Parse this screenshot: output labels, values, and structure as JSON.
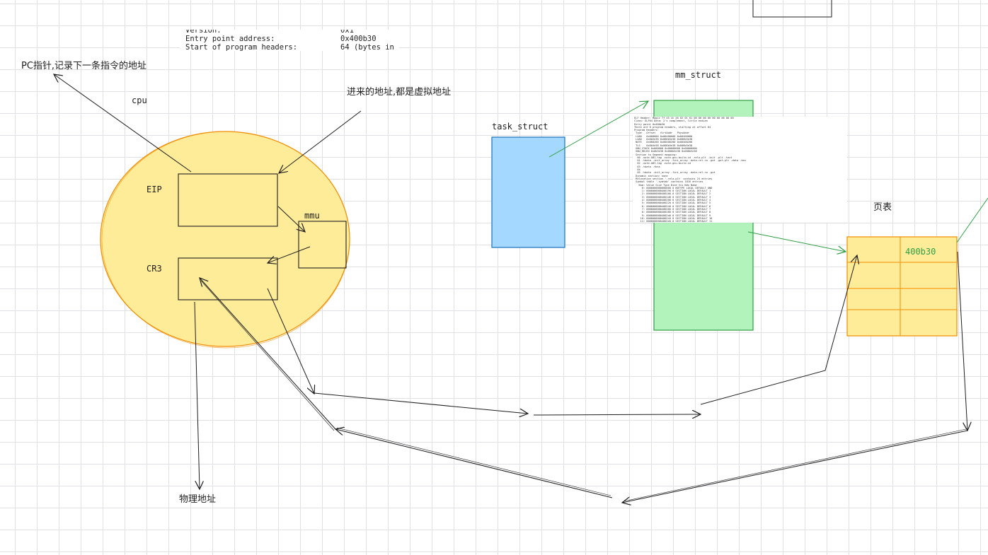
{
  "labels": {
    "pc_note": "PC指针,记录下一条指令的地址",
    "cpu": "cpu",
    "incoming_note": "进来的地址,都是虚拟地址",
    "eip": "EIP",
    "cr3": "CR3",
    "mmu": "mmu",
    "physical_addr": "物理地址",
    "task_struct": "task_struct",
    "mm_struct": "mm_struct",
    "page_table": "页表",
    "page_table_entry": "400b30"
  },
  "elf_header_snippet": [
    {
      "key": "Version:",
      "value": "0x1"
    },
    {
      "key": "Entry point address:",
      "value": "0x400b30"
    },
    {
      "key": "Start of program headers:",
      "value": "64 (bytes in"
    }
  ],
  "readelf_lines": [
    "ELF Header: Magic 7f 45 4c 46 02 01 01 00 00 00 00 00 00 00 00 00",
    "Class: ELF64 Data: 2's complement, little endian",
    "Entry point 0x400b30",
    "There are 8 program headers, starting at offset 64",
    "Program Headers:",
    " Type   Offset   VirtAddr   PhysAddr",
    " LOAD   0x000000 0x00400000 0x00400000",
    " LOAD   0x0b5e38 0x006b5e38 0x006b5e38",
    " NOTE   0x000200 0x00400200 0x00400200",
    " TLS    0x0b5e38 0x006b5e38 0x006b5e38",
    " GNU_STACK 0x000000 0x00000000 0x00000000",
    " GNU_RELRO 0x0b5e38 0x006b5e38 0x006b5e38",
    " Section to Segment mapping:",
    "  00 .note.ABI-tag .note.gnu.build-id .rela.plt .init .plt .text",
    "  01 .tdata .init_array .fini_array .data.rel.ro .got .got.plt .data .bss",
    "  02 .note.ABI-tag .note.gnu.build-id",
    "  03 .tdata .tbss",
    "  04",
    "  05 .tdata .init_array .fini_array .data.rel.ro .got",
    " Dynamic section: none",
    " Relocation section '.rela.plt' contains 24 entries",
    " Symbol table '.symtab' contains 1816 entries",
    "   Num: Value Size Type Bind Vis Ndx Name",
    "     0: 0000000000000000 0 NOTYPE LOCAL DEFAULT UND",
    "     1: 0000000000400190 0 SECTION LOCAL DEFAULT 1",
    "     2: 00000000004001b0 0 SECTION LOCAL DEFAULT 2",
    "     3: 00000000004001d8 0 SECTION LOCAL DEFAULT 3",
    "     4: 0000000000400200 0 SECTION LOCAL DEFAULT 4",
    "     5: 0000000000400220 0 SECTION LOCAL DEFAULT 5",
    "     6: 0000000000400240 0 SECTION LOCAL DEFAULT 6",
    "     7: 0000000000400260 0 SECTION LOCAL DEFAULT 7",
    "     8: 0000000000400280 0 SECTION LOCAL DEFAULT 8",
    "     9: 00000000004002a0 0 SECTION LOCAL DEFAULT 9",
    "    10: 00000000004002c0 0 SECTION LOCAL DEFAULT 10",
    "    11: 00000000004002e0 0 SECTION LOCAL DEFAULT 11"
  ],
  "colors": {
    "cpu_fill": "#ffec99",
    "cpu_stroke": "#f08c00",
    "task_struct_fill": "#a5d8ff",
    "task_struct_stroke": "#1971c2",
    "mm_struct_fill": "#b2f2bb",
    "mm_struct_stroke": "#2f9e44",
    "page_table_fill": "#ffec99",
    "page_table_stroke": "#f08c00",
    "arrow_dark": "#1e1e1e",
    "arrow_green": "#2f9e44"
  }
}
